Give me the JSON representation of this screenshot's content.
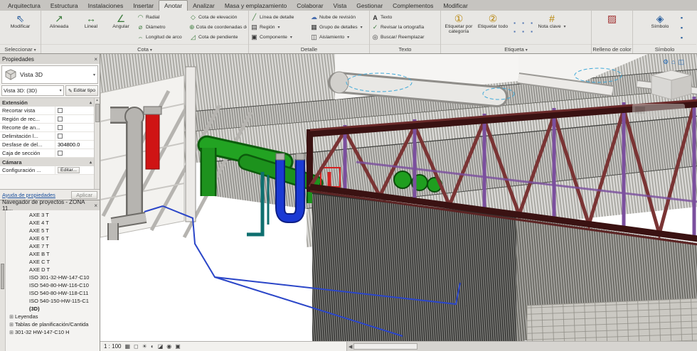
{
  "colors": {
    "accent-blue": "#2a6fba",
    "pipe-green": "#22a322",
    "pipe-red": "#cf1414",
    "pipe-blue": "#1a39d4",
    "pipe-teal": "#0e6f6f",
    "truss-dark": "#3a1212",
    "post-purple": "#7b4f9e"
  },
  "icons": {
    "chevron": "▾",
    "close": "×",
    "expand": "⊞",
    "collapse": "▴",
    "down": "▾",
    "modify": "⇖",
    "alineada": "↗",
    "lineal": "↔",
    "angular": "∠",
    "radial": "◠",
    "diametro": "⌀",
    "arco": "⌢",
    "elevacion": "◇",
    "coordenadas": "⊕",
    "pendiente": "◿",
    "linea": "╱",
    "region": "▤",
    "componente": "▣",
    "nube": "☁",
    "grupo": "▦",
    "aislamiento": "◫",
    "texto": "A",
    "revisar": "✓",
    "buscar": "◎",
    "tag1": "①",
    "tag2": "②",
    "nota": "#",
    "relleno": "▨",
    "simbolo": "◈",
    "dot": "▪",
    "cube": "▣",
    "edit": "✎",
    "left_arrow": "◀",
    "crop": "▦",
    "cropoff": "◻",
    "sun": "☀",
    "shadow": "◐",
    "isolate": "◪",
    "reveal": "◉",
    "wheel": "⚙",
    "home": "⌂",
    "options": "◫"
  },
  "ribbon": {
    "tabs": [
      {
        "label": "Arquitectura"
      },
      {
        "label": "Estructura"
      },
      {
        "label": "Instalaciones"
      },
      {
        "label": "Insertar"
      },
      {
        "label": "Anotar",
        "active": true
      },
      {
        "label": "Analizar"
      },
      {
        "label": "Masa y emplazamiento"
      },
      {
        "label": "Colaborar"
      },
      {
        "label": "Vista"
      },
      {
        "label": "Gestionar"
      },
      {
        "label": "Complementos"
      },
      {
        "label": "Modificar"
      }
    ],
    "seleccionar": {
      "label": "Seleccionar",
      "modify": "Modificar"
    },
    "cota": {
      "label": "Cota",
      "alineada": "Alineada",
      "lineal": "Lineal",
      "angular": "Angular",
      "radial": "Radial",
      "diametro": "Diámetro",
      "arco": "Longitud de arco",
      "elevacion": "Cota de elevación",
      "coordenadas": "Cota de coordenadas de punto",
      "pendiente": "Cota de pendiente"
    },
    "detalle": {
      "label": "Detalle",
      "linea": "Línea de detalle",
      "region": "Región",
      "componente": "Componente",
      "nube": "Nube de revisión",
      "grupo": "Grupo de detalles",
      "aislamiento": "Aislamiento"
    },
    "texto": {
      "label": "Texto",
      "texto": "Texto",
      "revisar": "Revisar la  ortografía",
      "buscar": "Buscar/ Reemplazar"
    },
    "etiqueta": {
      "label": "Etiqueta",
      "por_categoria": "Etiquetar por categoría",
      "todo": "Etiquetar todo",
      "nota": "Nota clave"
    },
    "relleno": {
      "label": "Relleno de color"
    },
    "simbolo": {
      "label": "Símbolo",
      "item": "Símbolo"
    }
  },
  "properties": {
    "title": "Propiedades",
    "type_name": "Vista 3D",
    "instance_label": "Vista 3D: (3D)",
    "edit_type": "Editar tipo",
    "section_extension": "Extensión",
    "rows": [
      {
        "label": "Recortar vista"
      },
      {
        "label": "Región de rec..."
      },
      {
        "label": "Recorte de an..."
      },
      {
        "label": "Delimitación l..."
      },
      {
        "label": "Desfase de del...",
        "value": "304800.0"
      },
      {
        "label": "Caja de sección"
      }
    ],
    "section_camera": "Cámara",
    "camera_row": {
      "label": "Configuración ...",
      "value": "Editar..."
    },
    "help": "Ayuda de propiedades",
    "apply": "Aplicar"
  },
  "browser": {
    "title": "Navegador de proyectos - ZONA 11...",
    "items": [
      {
        "pre": "",
        "label": "AXE 3 T",
        "cls": "lvl2"
      },
      {
        "pre": "",
        "label": "AXE 4 T",
        "cls": "lvl2"
      },
      {
        "pre": "",
        "label": "AXE 5 T",
        "cls": "lvl2"
      },
      {
        "pre": "",
        "label": "AXE 6 T",
        "cls": "lvl2"
      },
      {
        "pre": "",
        "label": "AXE 7 T",
        "cls": "lvl2"
      },
      {
        "pre": "",
        "label": "AXE B T",
        "cls": "lvl2"
      },
      {
        "pre": "",
        "label": "AXE C T",
        "cls": "lvl2"
      },
      {
        "pre": "",
        "label": "AXE D T",
        "cls": "lvl2"
      },
      {
        "pre": "",
        "label": "ISO 301-32-HW-147-C10",
        "cls": "lvl2"
      },
      {
        "pre": "",
        "label": "ISO 540-80-HW-116-C10",
        "cls": "lvl2"
      },
      {
        "pre": "",
        "label": "ISO 540-80-HW-118-C11",
        "cls": "lvl2"
      },
      {
        "pre": "",
        "label": "ISO 540-150-HW-115-C1",
        "cls": "lvl2"
      },
      {
        "pre": "",
        "label": "(3D)",
        "cls": "lvl2 bold"
      },
      {
        "pre": "⊞",
        "label": "Leyendas",
        "cls": "lvl1"
      },
      {
        "pre": "⊞",
        "label": "Tablas de planificación/Cantida",
        "cls": "lvl1"
      },
      {
        "pre": "⊞",
        "label": "301-32 HW-147-C10 H",
        "cls": "lvl1"
      }
    ]
  },
  "statusbar": {
    "scale": "1 : 100"
  }
}
